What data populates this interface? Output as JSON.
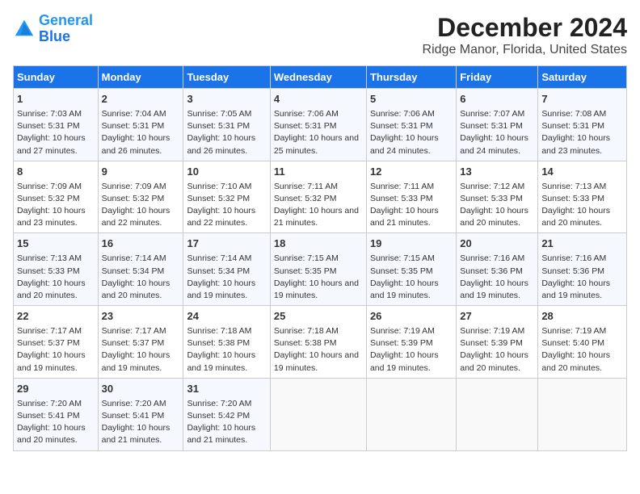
{
  "header": {
    "logo_line1": "General",
    "logo_line2": "Blue",
    "title": "December 2024",
    "subtitle": "Ridge Manor, Florida, United States"
  },
  "days_of_week": [
    "Sunday",
    "Monday",
    "Tuesday",
    "Wednesday",
    "Thursday",
    "Friday",
    "Saturday"
  ],
  "weeks": [
    [
      {
        "day": "1",
        "sunrise": "Sunrise: 7:03 AM",
        "sunset": "Sunset: 5:31 PM",
        "daylight": "Daylight: 10 hours and 27 minutes."
      },
      {
        "day": "2",
        "sunrise": "Sunrise: 7:04 AM",
        "sunset": "Sunset: 5:31 PM",
        "daylight": "Daylight: 10 hours and 26 minutes."
      },
      {
        "day": "3",
        "sunrise": "Sunrise: 7:05 AM",
        "sunset": "Sunset: 5:31 PM",
        "daylight": "Daylight: 10 hours and 26 minutes."
      },
      {
        "day": "4",
        "sunrise": "Sunrise: 7:06 AM",
        "sunset": "Sunset: 5:31 PM",
        "daylight": "Daylight: 10 hours and 25 minutes."
      },
      {
        "day": "5",
        "sunrise": "Sunrise: 7:06 AM",
        "sunset": "Sunset: 5:31 PM",
        "daylight": "Daylight: 10 hours and 24 minutes."
      },
      {
        "day": "6",
        "sunrise": "Sunrise: 7:07 AM",
        "sunset": "Sunset: 5:31 PM",
        "daylight": "Daylight: 10 hours and 24 minutes."
      },
      {
        "day": "7",
        "sunrise": "Sunrise: 7:08 AM",
        "sunset": "Sunset: 5:31 PM",
        "daylight": "Daylight: 10 hours and 23 minutes."
      }
    ],
    [
      {
        "day": "8",
        "sunrise": "Sunrise: 7:09 AM",
        "sunset": "Sunset: 5:32 PM",
        "daylight": "Daylight: 10 hours and 23 minutes."
      },
      {
        "day": "9",
        "sunrise": "Sunrise: 7:09 AM",
        "sunset": "Sunset: 5:32 PM",
        "daylight": "Daylight: 10 hours and 22 minutes."
      },
      {
        "day": "10",
        "sunrise": "Sunrise: 7:10 AM",
        "sunset": "Sunset: 5:32 PM",
        "daylight": "Daylight: 10 hours and 22 minutes."
      },
      {
        "day": "11",
        "sunrise": "Sunrise: 7:11 AM",
        "sunset": "Sunset: 5:32 PM",
        "daylight": "Daylight: 10 hours and 21 minutes."
      },
      {
        "day": "12",
        "sunrise": "Sunrise: 7:11 AM",
        "sunset": "Sunset: 5:33 PM",
        "daylight": "Daylight: 10 hours and 21 minutes."
      },
      {
        "day": "13",
        "sunrise": "Sunrise: 7:12 AM",
        "sunset": "Sunset: 5:33 PM",
        "daylight": "Daylight: 10 hours and 20 minutes."
      },
      {
        "day": "14",
        "sunrise": "Sunrise: 7:13 AM",
        "sunset": "Sunset: 5:33 PM",
        "daylight": "Daylight: 10 hours and 20 minutes."
      }
    ],
    [
      {
        "day": "15",
        "sunrise": "Sunrise: 7:13 AM",
        "sunset": "Sunset: 5:33 PM",
        "daylight": "Daylight: 10 hours and 20 minutes."
      },
      {
        "day": "16",
        "sunrise": "Sunrise: 7:14 AM",
        "sunset": "Sunset: 5:34 PM",
        "daylight": "Daylight: 10 hours and 20 minutes."
      },
      {
        "day": "17",
        "sunrise": "Sunrise: 7:14 AM",
        "sunset": "Sunset: 5:34 PM",
        "daylight": "Daylight: 10 hours and 19 minutes."
      },
      {
        "day": "18",
        "sunrise": "Sunrise: 7:15 AM",
        "sunset": "Sunset: 5:35 PM",
        "daylight": "Daylight: 10 hours and 19 minutes."
      },
      {
        "day": "19",
        "sunrise": "Sunrise: 7:15 AM",
        "sunset": "Sunset: 5:35 PM",
        "daylight": "Daylight: 10 hours and 19 minutes."
      },
      {
        "day": "20",
        "sunrise": "Sunrise: 7:16 AM",
        "sunset": "Sunset: 5:36 PM",
        "daylight": "Daylight: 10 hours and 19 minutes."
      },
      {
        "day": "21",
        "sunrise": "Sunrise: 7:16 AM",
        "sunset": "Sunset: 5:36 PM",
        "daylight": "Daylight: 10 hours and 19 minutes."
      }
    ],
    [
      {
        "day": "22",
        "sunrise": "Sunrise: 7:17 AM",
        "sunset": "Sunset: 5:37 PM",
        "daylight": "Daylight: 10 hours and 19 minutes."
      },
      {
        "day": "23",
        "sunrise": "Sunrise: 7:17 AM",
        "sunset": "Sunset: 5:37 PM",
        "daylight": "Daylight: 10 hours and 19 minutes."
      },
      {
        "day": "24",
        "sunrise": "Sunrise: 7:18 AM",
        "sunset": "Sunset: 5:38 PM",
        "daylight": "Daylight: 10 hours and 19 minutes."
      },
      {
        "day": "25",
        "sunrise": "Sunrise: 7:18 AM",
        "sunset": "Sunset: 5:38 PM",
        "daylight": "Daylight: 10 hours and 19 minutes."
      },
      {
        "day": "26",
        "sunrise": "Sunrise: 7:19 AM",
        "sunset": "Sunset: 5:39 PM",
        "daylight": "Daylight: 10 hours and 19 minutes."
      },
      {
        "day": "27",
        "sunrise": "Sunrise: 7:19 AM",
        "sunset": "Sunset: 5:39 PM",
        "daylight": "Daylight: 10 hours and 20 minutes."
      },
      {
        "day": "28",
        "sunrise": "Sunrise: 7:19 AM",
        "sunset": "Sunset: 5:40 PM",
        "daylight": "Daylight: 10 hours and 20 minutes."
      }
    ],
    [
      {
        "day": "29",
        "sunrise": "Sunrise: 7:20 AM",
        "sunset": "Sunset: 5:41 PM",
        "daylight": "Daylight: 10 hours and 20 minutes."
      },
      {
        "day": "30",
        "sunrise": "Sunrise: 7:20 AM",
        "sunset": "Sunset: 5:41 PM",
        "daylight": "Daylight: 10 hours and 21 minutes."
      },
      {
        "day": "31",
        "sunrise": "Sunrise: 7:20 AM",
        "sunset": "Sunset: 5:42 PM",
        "daylight": "Daylight: 10 hours and 21 minutes."
      },
      null,
      null,
      null,
      null
    ]
  ]
}
